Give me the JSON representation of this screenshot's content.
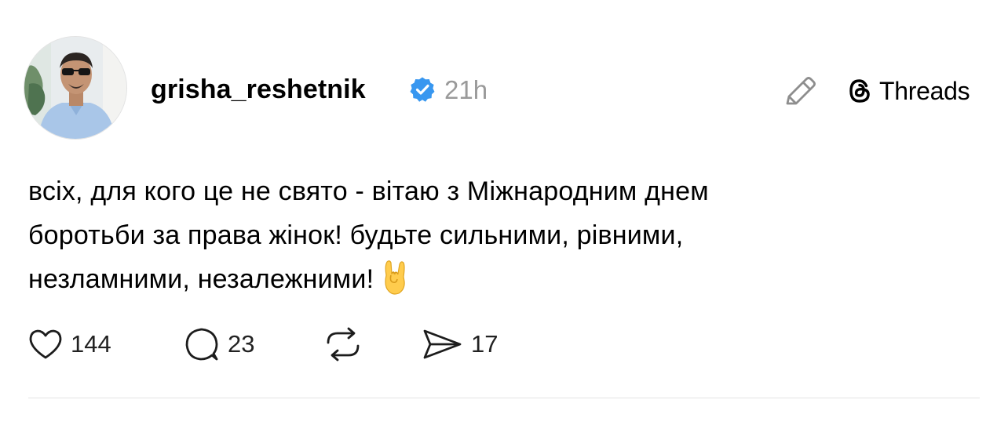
{
  "post": {
    "author": {
      "username": "grisha_reshetnik",
      "verified": true,
      "avatar_icon": "avatar-photo"
    },
    "time": "21h",
    "brand": {
      "icon": "threads-logo-icon",
      "label": "Threads"
    },
    "text_lines": [
      "всіх, для кого це не свято - вітаю з Міжнародним днем",
      "боротьби за права жінок! будьте сильними, рівними,",
      "незламними, незалежними!"
    ],
    "text_emoji": "🤘",
    "actions": {
      "like": {
        "icon": "heart-icon",
        "count": "144"
      },
      "reply": {
        "icon": "speech-bubble-icon",
        "count": "23"
      },
      "repost": {
        "icon": "repost-icon",
        "count": ""
      },
      "share": {
        "icon": "send-icon",
        "count": "17"
      }
    }
  },
  "colors": {
    "verified_badge": "#3897f0",
    "muted_text": "#9a9a9a",
    "icon_gray": "#8e8e8e",
    "text": "#000000"
  }
}
